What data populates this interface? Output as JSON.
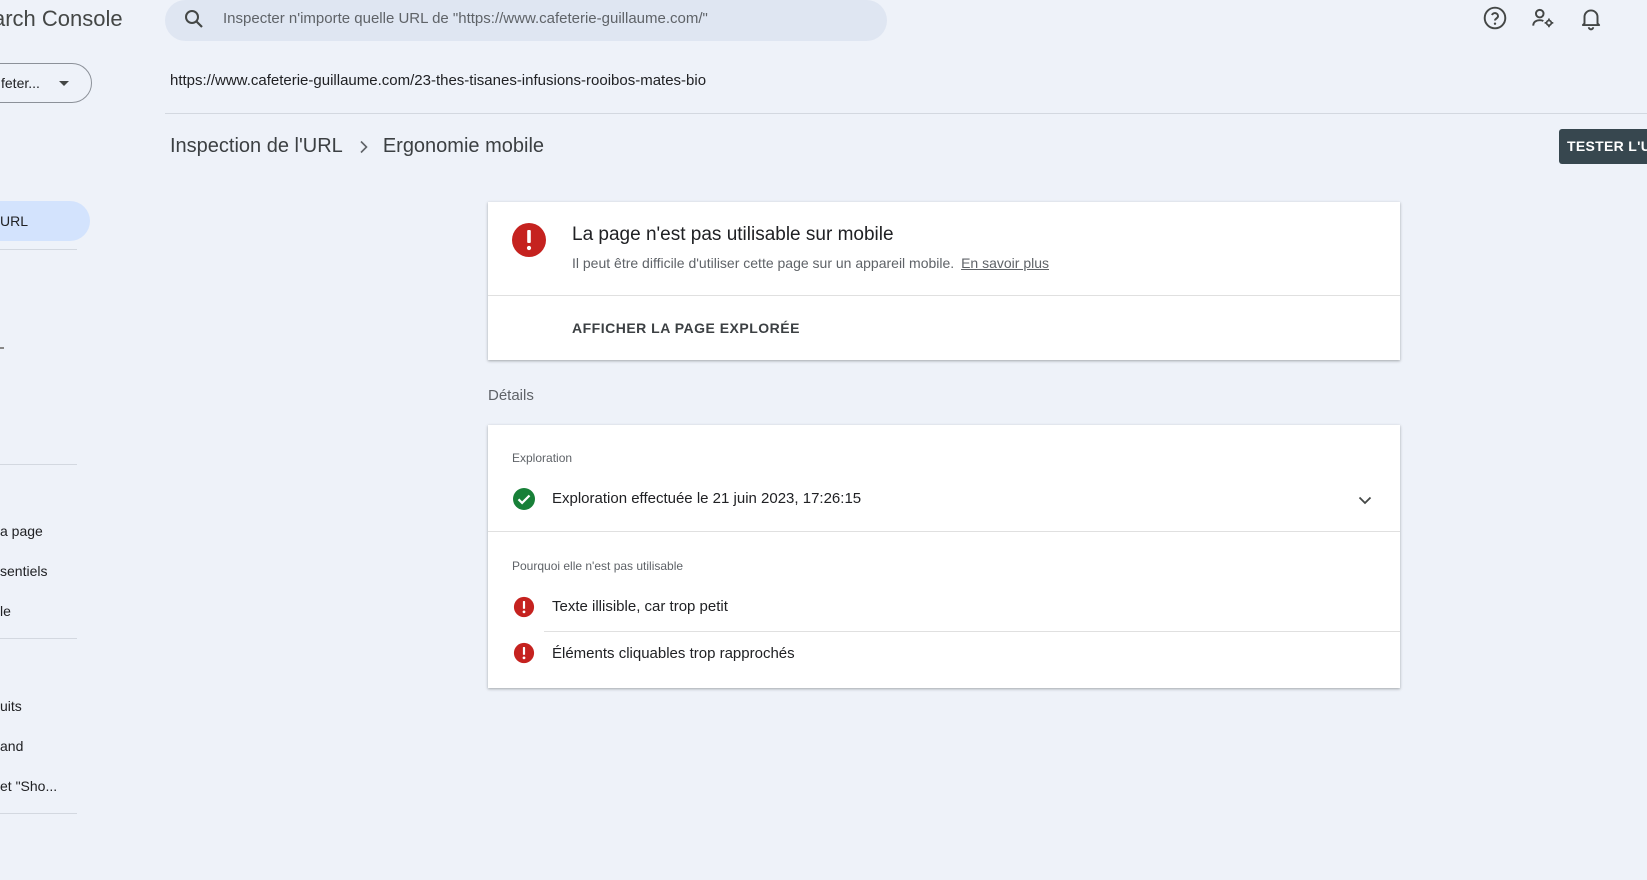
{
  "app": {
    "title": "arch Console"
  },
  "search": {
    "placeholder": "Inspecter n'importe quelle URL de \"https://www.cafeterie-guillaume.com/\""
  },
  "header_icons": [
    "help-icon",
    "manage-users-icon",
    "notifications-icon"
  ],
  "property": {
    "label": "feter..."
  },
  "inspected_url": "https://www.cafeterie-guillaume.com/23-thes-tisanes-infusions-rooibos-mates-bio",
  "breadcrumb": {
    "parent": "Inspection de l'URL",
    "current": "Ergonomie mobile"
  },
  "test_button": {
    "label": "TESTER L'UR"
  },
  "sidebar": {
    "active": "URL",
    "items": [
      "a page",
      "sentiels",
      "le",
      "uits",
      "and",
      "et \"Sho..."
    ]
  },
  "status": {
    "title": "La page n'est pas utilisable sur mobile",
    "subtitle": "Il peut être difficile d'utiliser cette page sur un appareil mobile.",
    "link": "En savoir plus",
    "action": "AFFICHER LA PAGE EXPLORÉE"
  },
  "details": {
    "label": "Détails",
    "crawl": {
      "section": "Exploration",
      "text": "Exploration effectuée le 21 juin 2023, 17:26:15"
    },
    "reasons": {
      "section": "Pourquoi elle n'est pas utilisable",
      "items": [
        "Texte illisible, car trop petit",
        "Éléments cliquables trop rapprochés"
      ]
    }
  },
  "colors": {
    "error": "#c5221f",
    "success": "#188038",
    "accent_bg": "#d3e3fd",
    "button_bg": "#37474f"
  }
}
